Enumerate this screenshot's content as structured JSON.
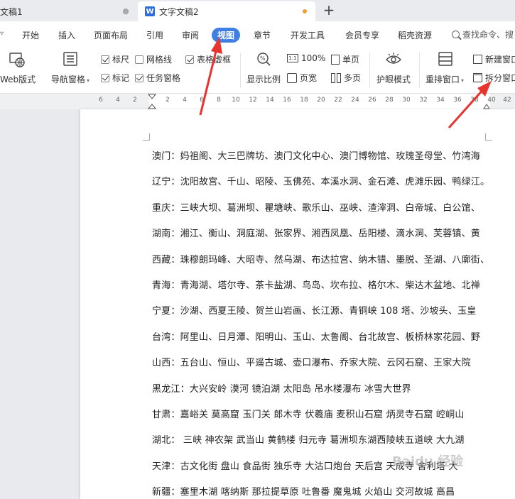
{
  "tabs": [
    {
      "label": "文稿1"
    },
    {
      "label": "文字文稿2",
      "icon_letter": "W"
    }
  ],
  "menu": {
    "items": [
      "开始",
      "插入",
      "页面布局",
      "引用",
      "审阅",
      "视图",
      "章节",
      "开发工具",
      "会员专享",
      "稻壳资源"
    ],
    "active": "视图",
    "search_label": "查找命令、搜"
  },
  "toolbar": {
    "web_layout": "Web版式",
    "nav_pane": "导航窗格",
    "ruler": "标尺",
    "gridlines": "网格线",
    "table_borders": "表格虚框",
    "markers": "标记",
    "task_pane": "任务窗格",
    "zoom_label": "显示比例",
    "zoom_100": "100%",
    "single_page": "单页",
    "page_width": "页宽",
    "multi_page": "多页",
    "eye_mode": "护眼模式",
    "rearrange": "重排窗口",
    "new_window": "新建窗口",
    "split_window": "拆分窗口"
  },
  "ruler_ticks": [
    "6",
    "4",
    "2",
    "2",
    "4",
    "6",
    "8",
    "10",
    "12",
    "14",
    "16",
    "18",
    "20",
    "22",
    "24",
    "26",
    "28",
    "30",
    "32",
    "34",
    "36",
    "38",
    "40",
    "42"
  ],
  "document": {
    "lines": [
      "澳门：妈祖阁、大三巴牌坊、澳门文化中心、澳门博物馆、玫瑰圣母堂、竹湾海",
      "辽宁：沈阳故宫、千山、昭陵、玉佛苑、本溪水洞、金石滩、虎滩乐园、鸭绿江。",
      "重庆：三峡大坝、葛洲坝、瞿塘峡、歌乐山、巫峡、渣滓洞、白帝城、白公馆、",
      "湖南：湘江、衡山、洞庭湖、张家界、湘西凤凰、岳阳楼、滴水洞、芙蓉镇、黄",
      "西藏：珠穆朗玛峰、大昭寺、然乌湖、布达拉宫、纳木错、墨脱、圣湖、八廓街、",
      "青海：青海湖、塔尔寺、茶卡盐湖、鸟岛、坎布拉、格尔木、柴达木盆地、北禅",
      "宁夏：沙湖、西夏王陵、贺兰山岩画、长江源、青铜峡 108 塔、沙坡头、玉皇",
      "台湾：阿里山、日月潭、阳明山、玉山、太鲁阁、台北故宫、板桥林家花园、野",
      "山西：五台山、恒山、平遥古城、壶口瀑布、乔家大院、云冈石窟、王家大院",
      "黑龙江：大兴安岭  漠河  镜泊湖  太阳岛  吊水楼瀑布  冰雪大世界",
      "甘肃：嘉峪关  莫高窟  玉门关  郎木寺  伏羲庙  麦积山石窟  炳灵寺石窟  崆峒山",
      "湖北：  三峡  神农架  武当山  黄鹤楼  归元寺  葛洲坝东湖西陵峡五道峡  大九湖",
      "天津：古文化街  盘山  食品街  独乐寺  大沽口炮台  天后宫  天成寺  舍利塔  大",
      "新疆：塞里木湖  喀纳斯  那拉提草原  吐鲁番  魔鬼城  火焰山  交河故城  高昌"
    ]
  },
  "watermark": "Baidu 经验",
  "colors": {
    "accent": "#3f7fe3",
    "annotation_arrow": "#e8332e",
    "unsaved_dot": "#f0a030"
  }
}
